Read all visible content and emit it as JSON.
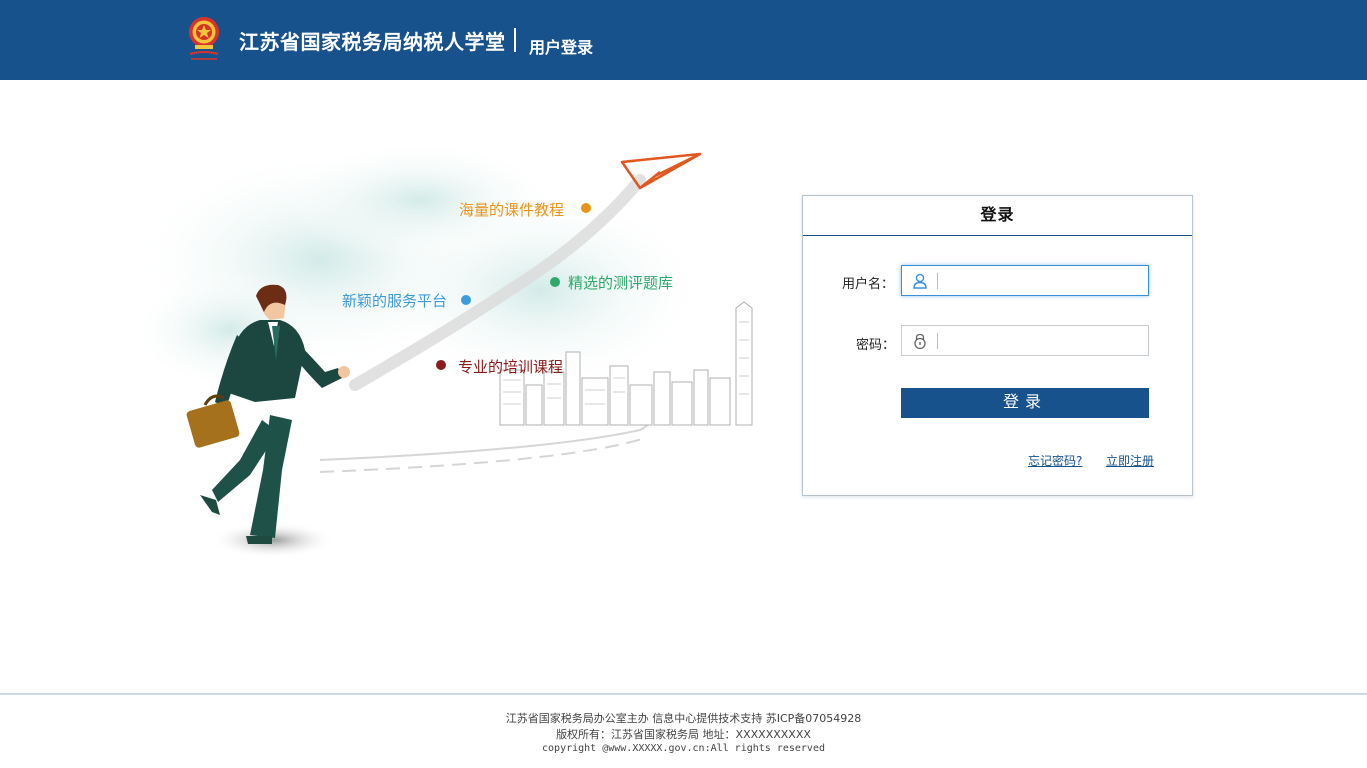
{
  "header": {
    "logo_icon": "tax-emblem-icon",
    "site_title": "江苏省国家税务局纳税人学堂",
    "sub_title": "用户登录",
    "bg_color": "#17528c"
  },
  "illustration": {
    "features": [
      {
        "label": "海量的课件教程",
        "color": "#e8941a"
      },
      {
        "label": "精选的测评题库",
        "color": "#2fa86b"
      },
      {
        "label": "新颖的服务平台",
        "color": "#3d9bd9"
      },
      {
        "label": "专业的培训课程",
        "color": "#8b1a1a"
      }
    ]
  },
  "login": {
    "title": "登录",
    "username_label": "用户名：",
    "username_icon": "user-icon",
    "username_value": "",
    "password_label": "密码：",
    "password_icon": "lock-icon",
    "password_value": "",
    "submit_label": "登录",
    "forgot_link": "忘记密码?",
    "register_link": "立即注册",
    "accent_color": "#17528c"
  },
  "footer": {
    "line1": "江苏省国家税务局办公室主办 信息中心提供技术支持 苏ICP备07054928",
    "line2": "版权所有：江苏省国家税务局 地址：XXXXXXXXXX",
    "line3": "copyright @www.XXXXX.gov.cn:All rights reserved"
  }
}
